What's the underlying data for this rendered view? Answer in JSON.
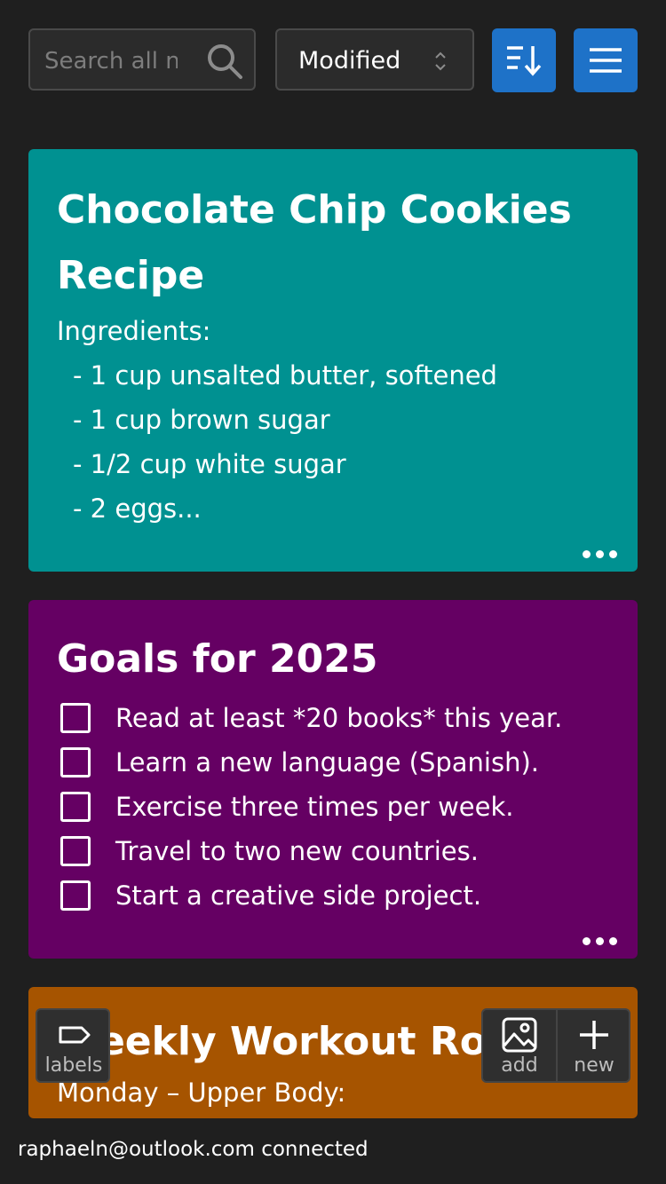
{
  "search": {
    "placeholder": "Search all notes"
  },
  "sort": {
    "selected": "Modified"
  },
  "notes": [
    {
      "title": "Chocolate Chip Cookies Recipe",
      "color": "#009191",
      "lines": [
        "Ingredients:",
        "- 1 cup unsalted butter, softened",
        "- 1 cup brown sugar",
        "- 1/2 cup white sugar",
        "- 2 eggs..."
      ]
    },
    {
      "title": "Goals for 2025",
      "color": "#650063",
      "items": [
        "Read at least *20 books* this year.",
        "Learn a new language (Spanish).",
        "Exercise three times per week.",
        "Travel to two new countries.",
        "Start a creative side project."
      ]
    },
    {
      "title": "Weekly Workout Routine",
      "color": "#a65400",
      "lines": [
        "Monday – Upper Body:"
      ]
    }
  ],
  "fab": {
    "labels": "labels",
    "add": "add",
    "new": "new"
  },
  "status": "raphaeln@outlook.com connected",
  "accent": "#1e72c8",
  "icons": [
    "search-icon",
    "chevron-updown-icon",
    "sort-descending-icon",
    "hamburger-menu-icon",
    "more-dots-icon",
    "tag-icon",
    "image-icon",
    "plus-icon"
  ]
}
